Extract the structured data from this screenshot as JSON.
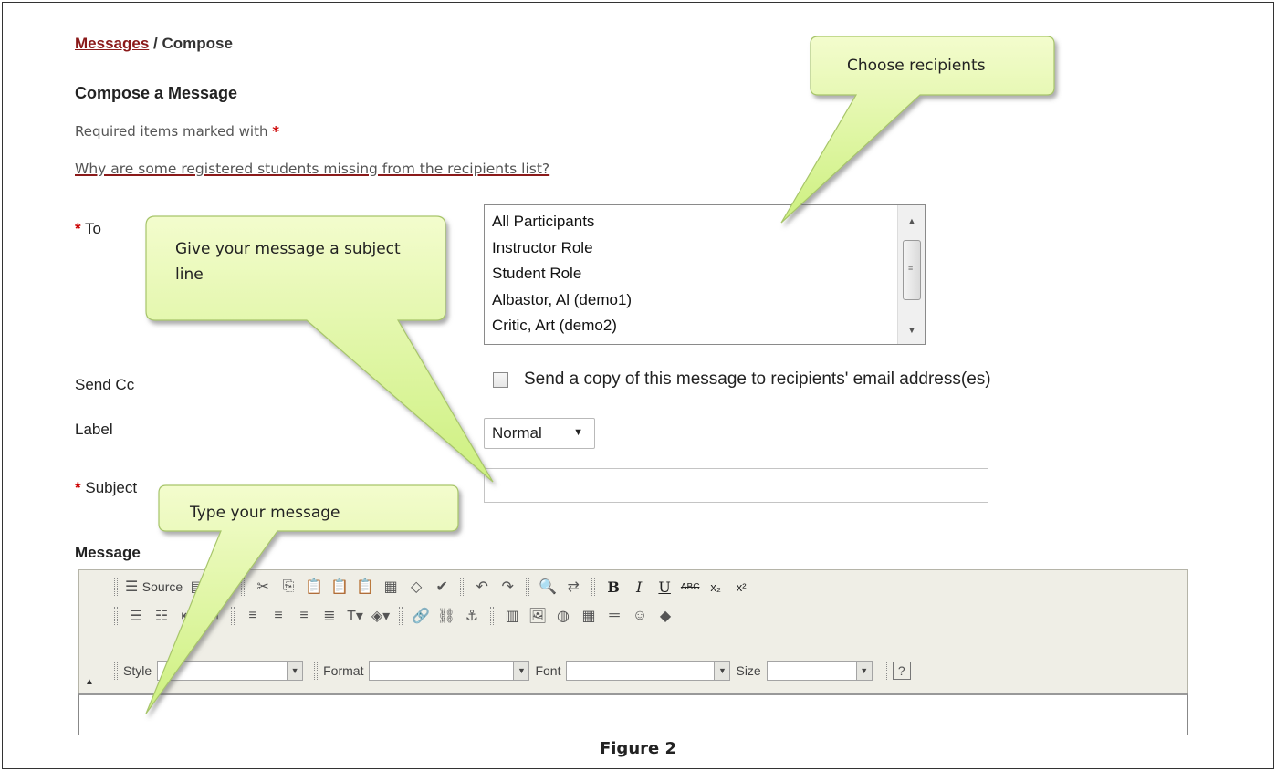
{
  "breadcrumb": {
    "link": "Messages",
    "separator": " / ",
    "current": "Compose"
  },
  "page_title": "Compose a Message",
  "required_note": {
    "text": "Required items marked with ",
    "star": "*"
  },
  "help_link": "Why are some registered students missing from the recipients list?",
  "fields": {
    "to_label": "To",
    "recipients": [
      "All Participants",
      "Instructor Role",
      "Student Role",
      "Albastor, Al (demo1)",
      "Critic, Art (demo2)"
    ],
    "send_cc_label": "Send Cc",
    "send_cc_text": "Send a copy of this message to recipients' email address(es)",
    "label_label": "Label",
    "label_value": "Normal",
    "subject_label": "Subject",
    "subject_value": "",
    "message_label": "Message",
    "required_star": "*"
  },
  "editor": {
    "source_label": "Source",
    "style_label": "Style",
    "format_label": "Format",
    "font_label": "Font",
    "size_label": "Size"
  },
  "callouts": {
    "recipients": "Choose recipients",
    "subject": "Give your message a subject line",
    "message": "Type your message"
  },
  "caption": "Figure 2",
  "colors": {
    "link_red": "#8b1a1a",
    "callout_green": "#d9f59a",
    "required_red": "#cc0000"
  }
}
